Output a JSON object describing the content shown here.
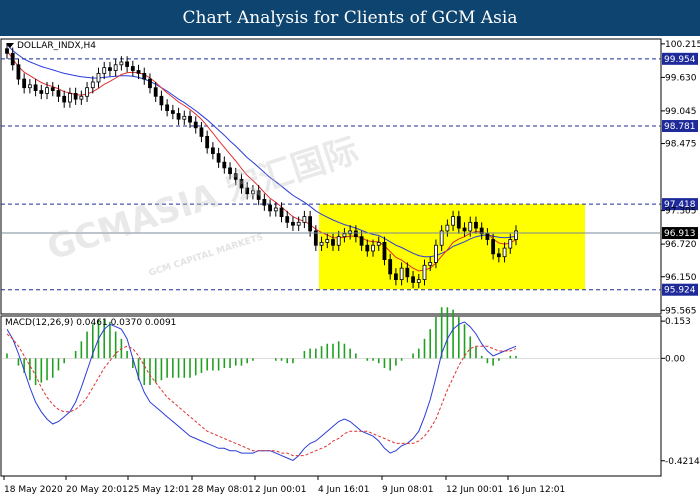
{
  "header": {
    "title": "Chart Analysis for Clients of GCM Asia"
  },
  "watermark": {
    "text": "GCMASIA 宏汇国际",
    "subtext": "GCM CAPITAL MARKETS"
  },
  "colors": {
    "background": "#ffffff",
    "title_bar": "#0e4470",
    "price_ma_fast": "#e03030",
    "price_ma_slow": "#2a3cd8",
    "candle": "#000000",
    "box": "#ffff00",
    "level_line": "#1a2d9a",
    "price_tag": "#1e2a9a",
    "macd_hist": "#20a020",
    "macd_line": "#2a3cd8",
    "signal_line": "#e03030"
  },
  "chart_data": [
    {
      "type": "candlestick",
      "symbol_label": "DOLLAR_INDX,H4",
      "ylim": [
        95.5,
        100.3
      ],
      "y_ticks": [
        "100.215",
        "99.630",
        "99.045",
        "98.475",
        "97.305",
        "96.720",
        "96.150",
        "95.565"
      ],
      "x_ticks": [
        "18 May 2020",
        "20 May 20:01",
        "25 May 12:01",
        "28 May 08:01",
        "2 Jun 00:01",
        "4 Jun 16:01",
        "9 Jun 08:01",
        "12 Jun 00:01",
        "16 Jun 12:01"
      ],
      "levels": [
        {
          "value": 99.954,
          "label": "99.954"
        },
        {
          "value": 98.781,
          "label": "98.781"
        },
        {
          "value": 97.418,
          "label": "97.418"
        },
        {
          "value": 95.924,
          "label": "95.924"
        }
      ],
      "current_price": {
        "value": 96.913,
        "label": "96.913"
      },
      "highlight_box": {
        "y_top": 97.42,
        "y_bottom": 95.93
      },
      "close": [
        100.05,
        99.85,
        99.6,
        99.45,
        99.5,
        99.4,
        99.35,
        99.45,
        99.4,
        99.3,
        99.2,
        99.35,
        99.25,
        99.3,
        99.45,
        99.55,
        99.7,
        99.8,
        99.75,
        99.85,
        99.9,
        99.82,
        99.75,
        99.7,
        99.6,
        99.45,
        99.3,
        99.15,
        99.05,
        99.0,
        98.9,
        98.95,
        98.85,
        98.75,
        98.6,
        98.4,
        98.3,
        98.15,
        98.05,
        97.95,
        97.85,
        97.7,
        97.6,
        97.65,
        97.5,
        97.4,
        97.3,
        97.35,
        97.2,
        97.1,
        97.05,
        97.1,
        97.2,
        96.95,
        96.7,
        96.75,
        96.8,
        96.7,
        96.85,
        96.9,
        96.95,
        96.85,
        96.7,
        96.6,
        96.7,
        96.75,
        96.45,
        96.2,
        96.1,
        96.3,
        96.15,
        96.05,
        96.1,
        96.35,
        96.4,
        96.7,
        96.95,
        97.05,
        97.2,
        97.0,
        96.95,
        97.1,
        97.0,
        96.9,
        96.8,
        96.55,
        96.5,
        96.65,
        96.8,
        96.95
      ],
      "ma_fast": [
        100.1,
        99.95,
        99.82,
        99.72,
        99.66,
        99.6,
        99.54,
        99.5,
        99.47,
        99.43,
        99.38,
        99.36,
        99.33,
        99.32,
        99.34,
        99.38,
        99.44,
        99.51,
        99.56,
        99.62,
        99.68,
        99.71,
        99.72,
        99.71,
        99.68,
        99.62,
        99.54,
        99.45,
        99.36,
        99.28,
        99.2,
        99.14,
        99.07,
        98.99,
        98.9,
        98.78,
        98.66,
        98.53,
        98.41,
        98.29,
        98.17,
        98.04,
        97.92,
        97.83,
        97.73,
        97.62,
        97.52,
        97.45,
        97.37,
        97.28,
        97.2,
        97.15,
        97.12,
        97.06,
        96.98,
        96.92,
        96.88,
        96.83,
        96.83,
        96.84,
        96.86,
        96.86,
        96.83,
        96.78,
        96.76,
        96.76,
        96.69,
        96.59,
        96.49,
        96.44,
        96.37,
        96.3,
        96.25,
        96.27,
        96.3,
        96.39,
        96.51,
        96.62,
        96.75,
        96.81,
        96.85,
        96.91,
        96.94,
        96.93,
        96.9,
        96.81,
        96.74,
        96.72,
        96.74,
        96.8
      ],
      "ma_slow": [
        100.2,
        100.1,
        100.02,
        99.95,
        99.9,
        99.86,
        99.82,
        99.79,
        99.76,
        99.73,
        99.7,
        99.68,
        99.66,
        99.64,
        99.63,
        99.62,
        99.62,
        99.63,
        99.64,
        99.65,
        99.66,
        99.66,
        99.65,
        99.63,
        99.6,
        99.56,
        99.51,
        99.45,
        99.39,
        99.32,
        99.25,
        99.19,
        99.12,
        99.05,
        98.97,
        98.89,
        98.8,
        98.71,
        98.62,
        98.52,
        98.43,
        98.33,
        98.23,
        98.15,
        98.06,
        97.97,
        97.88,
        97.81,
        97.73,
        97.65,
        97.57,
        97.51,
        97.45,
        97.38,
        97.3,
        97.24,
        97.19,
        97.14,
        97.1,
        97.06,
        97.03,
        97.0,
        96.96,
        96.92,
        96.89,
        96.87,
        96.82,
        96.76,
        96.7,
        96.66,
        96.61,
        96.56,
        96.52,
        96.5,
        96.5,
        96.52,
        96.56,
        96.61,
        96.68,
        96.72,
        96.76,
        96.81,
        96.85,
        96.87,
        96.88,
        96.86,
        96.84,
        96.83,
        96.84,
        96.86
      ]
    },
    {
      "type": "macd",
      "label": "MACD(12,26,9) 0.0461 0.0370 0.0091",
      "ylim": [
        -0.48,
        0.17
      ],
      "y_ticks": [
        "0.153",
        "0.00",
        "-0.4214"
      ],
      "macd": [
        0.12,
        0.08,
        0.02,
        -0.05,
        -0.12,
        -0.18,
        -0.22,
        -0.25,
        -0.27,
        -0.26,
        -0.24,
        -0.22,
        -0.18,
        -0.12,
        -0.05,
        0.02,
        0.08,
        0.12,
        0.14,
        0.13,
        0.12,
        0.08,
        0.0,
        -0.08,
        -0.14,
        -0.18,
        -0.2,
        -0.22,
        -0.24,
        -0.26,
        -0.28,
        -0.3,
        -0.32,
        -0.33,
        -0.34,
        -0.35,
        -0.36,
        -0.37,
        -0.37,
        -0.38,
        -0.38,
        -0.39,
        -0.39,
        -0.39,
        -0.38,
        -0.38,
        -0.38,
        -0.39,
        -0.4,
        -0.41,
        -0.42,
        -0.4,
        -0.37,
        -0.35,
        -0.34,
        -0.32,
        -0.3,
        -0.28,
        -0.26,
        -0.25,
        -0.26,
        -0.28,
        -0.3,
        -0.31,
        -0.32,
        -0.34,
        -0.37,
        -0.39,
        -0.38,
        -0.36,
        -0.35,
        -0.33,
        -0.3,
        -0.24,
        -0.17,
        -0.08,
        0.02,
        0.08,
        0.12,
        0.14,
        0.15,
        0.13,
        0.1,
        0.06,
        0.03,
        0.01,
        0.02,
        0.03,
        0.04,
        0.05
      ],
      "signal": [
        0.1,
        0.08,
        0.05,
        0.01,
        -0.03,
        -0.07,
        -0.12,
        -0.16,
        -0.19,
        -0.21,
        -0.22,
        -0.22,
        -0.21,
        -0.19,
        -0.16,
        -0.12,
        -0.08,
        -0.04,
        -0.01,
        0.02,
        0.04,
        0.05,
        0.04,
        0.01,
        -0.03,
        -0.07,
        -0.1,
        -0.13,
        -0.16,
        -0.18,
        -0.2,
        -0.22,
        -0.24,
        -0.26,
        -0.28,
        -0.3,
        -0.31,
        -0.32,
        -0.33,
        -0.34,
        -0.35,
        -0.36,
        -0.37,
        -0.38,
        -0.38,
        -0.38,
        -0.38,
        -0.38,
        -0.39,
        -0.39,
        -0.4,
        -0.4,
        -0.4,
        -0.39,
        -0.38,
        -0.37,
        -0.36,
        -0.34,
        -0.33,
        -0.31,
        -0.3,
        -0.3,
        -0.3,
        -0.3,
        -0.31,
        -0.32,
        -0.33,
        -0.34,
        -0.35,
        -0.35,
        -0.35,
        -0.35,
        -0.34,
        -0.32,
        -0.29,
        -0.25,
        -0.19,
        -0.13,
        -0.08,
        -0.03,
        0.01,
        0.04,
        0.05,
        0.05,
        0.05,
        0.04,
        0.03,
        0.03,
        0.03,
        0.04
      ]
    }
  ]
}
